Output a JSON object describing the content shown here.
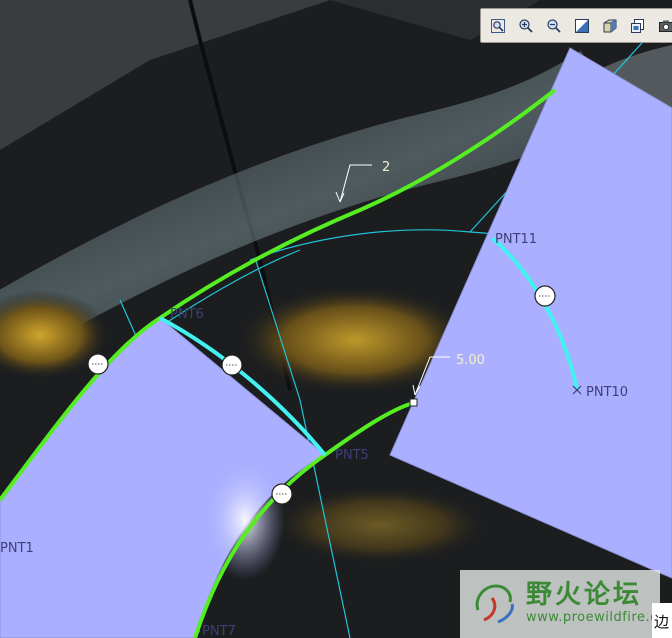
{
  "toolbar": {
    "buttons": [
      {
        "name": "refit-view-button",
        "icon": "refit-icon"
      },
      {
        "name": "zoom-in-button",
        "icon": "zoom-in-icon"
      },
      {
        "name": "zoom-out-button",
        "icon": "zoom-out-icon"
      },
      {
        "name": "repaint-button",
        "icon": "repaint-icon"
      },
      {
        "name": "orient-button",
        "icon": "cube-icon"
      },
      {
        "name": "saved-views-button",
        "icon": "saved-views-icon"
      },
      {
        "name": "camera-button",
        "icon": "camera-icon"
      }
    ]
  },
  "viewport": {
    "labels": {
      "pnt11": "PNT11",
      "pnt10": "PNT10",
      "pnt1": "PNT1",
      "pnt7": "PNT7",
      "pnt5": "PNT5",
      "pnt_partial": "PNT6"
    },
    "dimensions": {
      "top": "2",
      "mid": "5.00"
    }
  },
  "watermark": {
    "title": "野火论坛",
    "url": "www.proewildfire.cn"
  },
  "status_panel": {
    "char": "边"
  },
  "colors": {
    "surface": "#aab0ff",
    "edge_green": "#55ee22",
    "edge_cyan": "#44f0f0",
    "construction": "#22c4d8"
  }
}
